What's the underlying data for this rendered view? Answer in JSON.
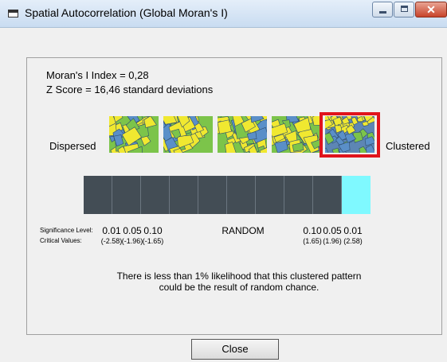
{
  "window": {
    "title": "Spatial Autocorrelation (Global Moran's I)"
  },
  "stats": {
    "morans_index": "Moran's I Index = 0,28",
    "z_score": "Z Score = 16,46 standard deviations"
  },
  "scale": {
    "left_label": "Dispersed",
    "right_label": "Clustered",
    "selected_pattern": 5
  },
  "significance": {
    "level_label": "Significance Level:",
    "critical_label": "Critical Values:",
    "levels": [
      "0.01",
      "0.05",
      "0.10",
      "RANDOM",
      "0.10",
      "0.05",
      "0.01"
    ],
    "critical": [
      "(-2.58)",
      "(-1.96)",
      "(-1.65)",
      "(1.65)",
      "(1.96)",
      "(2.58)"
    ]
  },
  "highlight_segment": 9,
  "message": {
    "line1": "There is less than 1% likelihood that this clustered pattern",
    "line2": "could be the result of random chance."
  },
  "buttons": {
    "close": "Close"
  },
  "colors": {
    "highlight": "#7ff9ff",
    "bar": "#434d55",
    "selection": "#e0141c"
  }
}
